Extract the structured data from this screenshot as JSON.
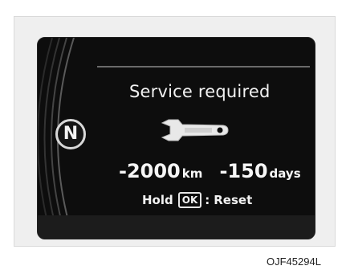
{
  "cluster": {
    "gear": "N",
    "title": "Service required",
    "distance_value": "-2000",
    "distance_unit": "km",
    "days_value": "-150",
    "days_unit": "days",
    "hold_label": "Hold",
    "ok_label": "OK",
    "colon": ":",
    "reset_label": "Reset",
    "icon": "wrench-icon"
  },
  "figure_code": "OJF45294L",
  "colors": {
    "screen": "#0d0d0d",
    "text": "#f2f2f2",
    "panel": "#efefef"
  }
}
